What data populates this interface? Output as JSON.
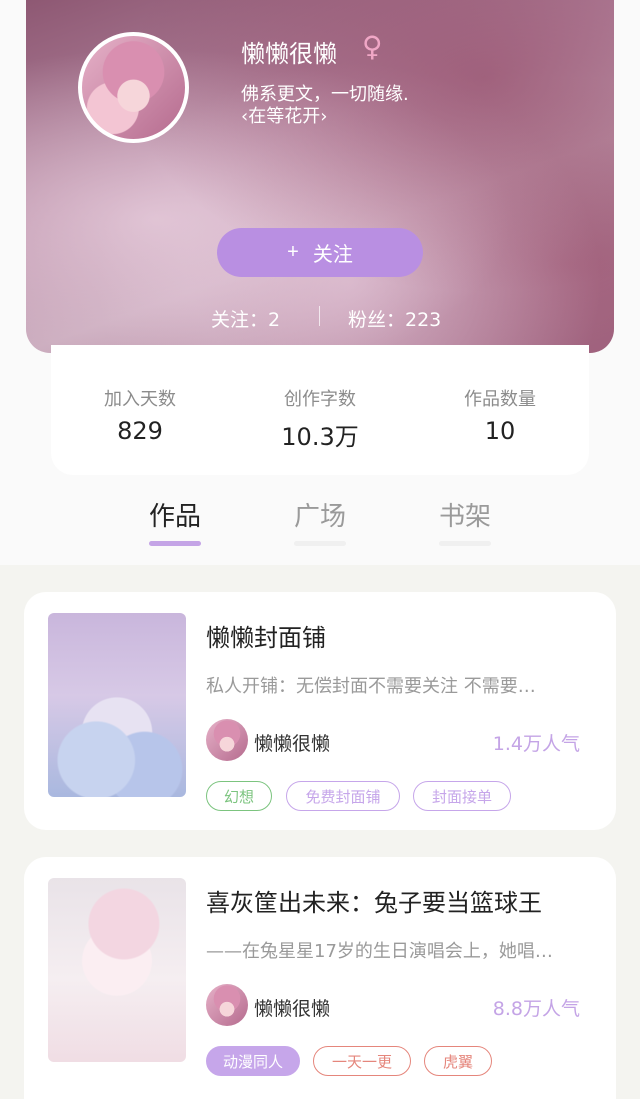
{
  "profile": {
    "name": "懒懒很懒",
    "gender_icon": "female-symbol-icon",
    "gender_symbol": "♀",
    "bio_line1": "佛系更文，一切随缘.",
    "bio_line2": "‹在等花开›",
    "follow_plus": "+",
    "follow_label": "关注",
    "following_text": "关注：2",
    "fans_text": "粉丝：223"
  },
  "stats": [
    {
      "label": "加入天数",
      "value": "829"
    },
    {
      "label": "创作字数",
      "value": "10.3万"
    },
    {
      "label": "作品数量",
      "value": "10"
    }
  ],
  "tabs": [
    {
      "label": "作品",
      "active": true
    },
    {
      "label": "广场",
      "active": false
    },
    {
      "label": "书架",
      "active": false
    }
  ],
  "works": [
    {
      "title": "懒懒封面铺",
      "desc": "私人开铺：无偿封面不需要关注 不需要…",
      "author": "懒懒很懒",
      "popularity": "1.4万人气",
      "tags": [
        "幻想",
        "免费封面铺",
        "封面接单"
      ]
    },
    {
      "title": "喜灰筐出未来：兔子要当篮球王",
      "desc": "——在兔星星17岁的生日演唱会上，她唱…",
      "author": "懒懒很懒",
      "popularity": "8.8万人气",
      "tags": [
        "动漫同人",
        "一天一更",
        "虎翼"
      ]
    }
  ],
  "colors": {
    "accent": "#b98fe2",
    "popularity": "#c4a4e6",
    "tag_green": "#7cc47f",
    "tag_purple": "#c6a6ea",
    "tag_red": "#e5867c"
  }
}
